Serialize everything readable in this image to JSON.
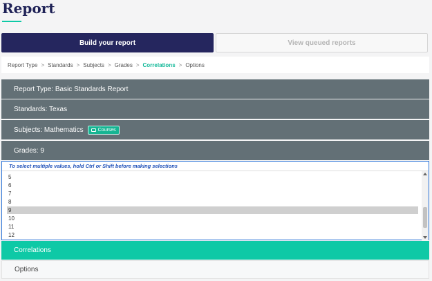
{
  "page": {
    "title": "Report"
  },
  "tabs": {
    "build": "Build your report",
    "queued": "View queued reports"
  },
  "breadcrumb": {
    "items": [
      "Report Type",
      "Standards",
      "Subjects",
      "Grades",
      "Correlations",
      "Options"
    ],
    "active_index": 4,
    "separator": ">"
  },
  "summary": {
    "report_type": "Report Type: Basic Standards Report",
    "standards": "Standards: Texas",
    "subjects": "Subjects: Mathematics",
    "courses_badge": "Courses",
    "grades": "Grades: 9"
  },
  "grades_panel": {
    "hint": "To select multiple values, hold Ctrl or Shift before making selections",
    "options": [
      "5",
      "6",
      "7",
      "8",
      "9",
      "10",
      "11",
      "12"
    ],
    "selected": "9"
  },
  "sections": {
    "correlations": "Correlations",
    "options": "Options"
  },
  "colors": {
    "accent": "#0ec9a6",
    "navy": "#25265e",
    "row_bg": "#637076",
    "link_blue": "#1d4fb8"
  }
}
